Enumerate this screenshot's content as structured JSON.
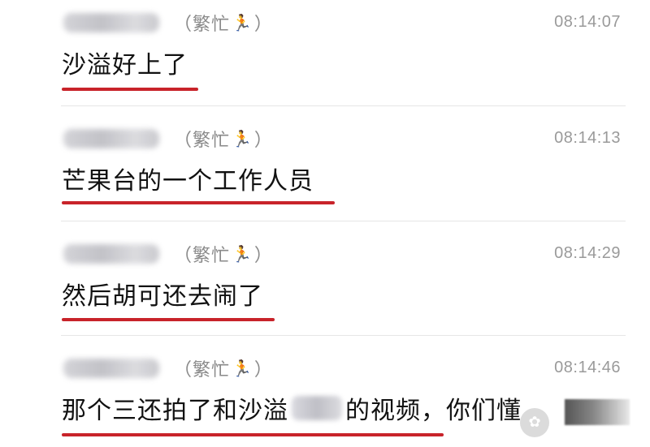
{
  "messages": [
    {
      "status_prefix": "（繁忙",
      "status_suffix": "）",
      "time": "08:14:07",
      "text": "沙溢好上了"
    },
    {
      "status_prefix": "（繁忙",
      "status_suffix": "）",
      "time": "08:14:13",
      "text": "芒果台的一个工作人员"
    },
    {
      "status_prefix": "（繁忙",
      "status_suffix": "）",
      "time": "08:14:29",
      "text": "然后胡可还去闹了"
    },
    {
      "status_prefix": "（繁忙",
      "status_suffix": "）",
      "time": "08:14:46",
      "text_before": "那个三还拍了和沙溢",
      "text_after": "的视频，你们懂"
    }
  ],
  "icons": {
    "status": "running-person-icon",
    "watermark": "wechat-logo-icon"
  },
  "colors": {
    "underline": "#c8232a",
    "status_text": "#8a8a8a",
    "time_text": "#9a9a9a"
  }
}
